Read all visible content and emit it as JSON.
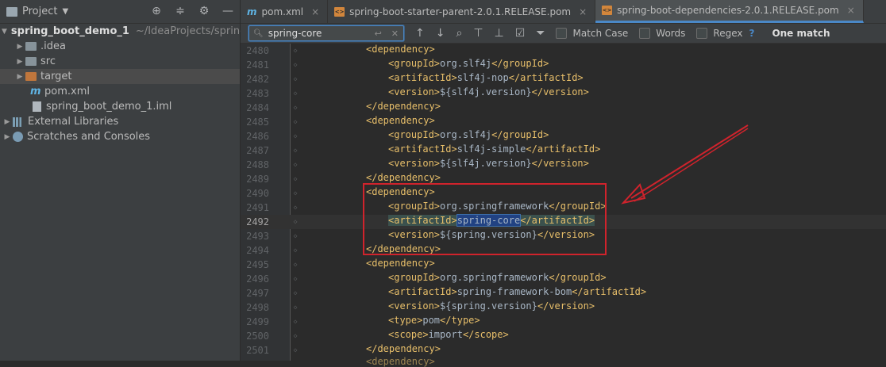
{
  "project_panel": {
    "title": "Project",
    "root": {
      "name": "spring_boot_demo_1",
      "path": "~/IdeaProjects/spring"
    },
    "items": [
      {
        "label": ".idea"
      },
      {
        "label": "src"
      },
      {
        "label": "target"
      },
      {
        "label": "pom.xml"
      },
      {
        "label": "spring_boot_demo_1.iml"
      }
    ],
    "external_libraries": "External Libraries",
    "scratches": "Scratches and Consoles"
  },
  "tabs": [
    {
      "label": "pom.xml"
    },
    {
      "label": "spring-boot-starter-parent-2.0.1.RELEASE.pom"
    },
    {
      "label": "spring-boot-dependencies-2.0.1.RELEASE.pom"
    }
  ],
  "find": {
    "query": "spring-core",
    "match_case": "Match Case",
    "words": "Words",
    "regex": "Regex",
    "help": "?",
    "result": "One match"
  },
  "editor": {
    "current_line": "2492",
    "lines": [
      {
        "n": "2480"
      },
      {
        "n": "2481"
      },
      {
        "n": "2482"
      },
      {
        "n": "2483"
      },
      {
        "n": "2484"
      },
      {
        "n": "2485"
      },
      {
        "n": "2486"
      },
      {
        "n": "2487"
      },
      {
        "n": "2488"
      },
      {
        "n": "2489"
      },
      {
        "n": "2490"
      },
      {
        "n": "2491"
      },
      {
        "n": "2492"
      },
      {
        "n": "2493"
      },
      {
        "n": "2494"
      },
      {
        "n": "2495"
      },
      {
        "n": "2496"
      },
      {
        "n": "2497"
      },
      {
        "n": "2498"
      },
      {
        "n": "2499"
      },
      {
        "n": "2500"
      },
      {
        "n": "2501"
      }
    ],
    "code": {
      "l2480": "<dependency>",
      "l2481a": "<groupId>",
      "l2481b": "org.slf4j",
      "l2481c": "</groupId>",
      "l2482a": "<artifactId>",
      "l2482b": "slf4j-nop",
      "l2482c": "</artifactId>",
      "l2483a": "<version>",
      "l2483b": "${slf4j.version}",
      "l2483c": "</version>",
      "l2484": "</dependency>",
      "l2485": "<dependency>",
      "l2486a": "<groupId>",
      "l2486b": "org.slf4j",
      "l2486c": "</groupId>",
      "l2487a": "<artifactId>",
      "l2487b": "slf4j-simple",
      "l2487c": "</artifactId>",
      "l2488a": "<version>",
      "l2488b": "${slf4j.version}",
      "l2488c": "</version>",
      "l2489": "</dependency>",
      "l2490": "<dependency>",
      "l2491a": "<groupId>",
      "l2491b": "org.springframework",
      "l2491c": "</groupId>",
      "l2492a": "<artifactId>",
      "l2492b": "spring-core",
      "l2492c": "</artifactId>",
      "l2493a": "<version>",
      "l2493b": "${spring.version}",
      "l2493c": "</version>",
      "l2494": "</dependency>",
      "l2495": "<dependency>",
      "l2496a": "<groupId>",
      "l2496b": "org.springframework",
      "l2496c": "</groupId>",
      "l2497a": "<artifactId>",
      "l2497b": "spring-framework-bom",
      "l2497c": "</artifactId>",
      "l2498a": "<version>",
      "l2498b": "${spring.version}",
      "l2498c": "</version>",
      "l2499a": "<type>",
      "l2499b": "pom",
      "l2499c": "</type>",
      "l2500a": "<scope>",
      "l2500b": "import",
      "l2500c": "</scope>",
      "l2501": "</dependency>",
      "l2502": "<dependency>"
    }
  },
  "colors": {
    "accent": "#4a88c7",
    "annotation": "#d0232c",
    "tag": "#e8bf6a",
    "text": "#a9b7c6"
  }
}
